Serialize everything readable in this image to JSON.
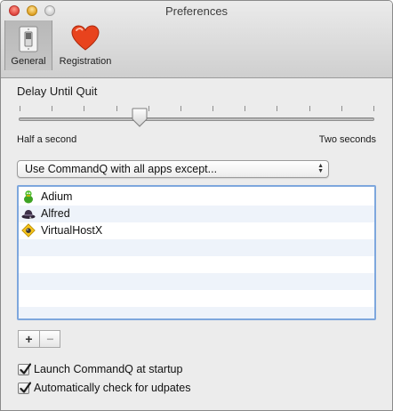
{
  "window": {
    "title": "Preferences"
  },
  "toolbar": {
    "items": [
      {
        "label": "General",
        "icon": "light-switch-icon",
        "selected": true
      },
      {
        "label": "Registration",
        "icon": "heart-icon",
        "selected": false
      }
    ]
  },
  "delay": {
    "label": "Delay Until Quit",
    "min_label": "Half a second",
    "max_label": "Two seconds",
    "tick_count": 12,
    "value_fraction": 0.34
  },
  "mode_select": {
    "value": "Use CommandQ with all apps except..."
  },
  "app_list": {
    "items": [
      {
        "name": "Adium",
        "icon": "adium-duck-icon"
      },
      {
        "name": "Alfred",
        "icon": "alfred-hat-icon"
      },
      {
        "name": "VirtualHostX",
        "icon": "virtualhostx-icon"
      }
    ],
    "empty_rows": 4,
    "focus_color": "#7ea7dd",
    "alt_row_color": "#eef3fa"
  },
  "list_buttons": {
    "add": "+",
    "remove": "−"
  },
  "options": {
    "launch_at_startup": {
      "label": "Launch CommandQ at startup",
      "checked": true
    },
    "auto_check_updates": {
      "label": "Automatically check for udpates",
      "checked": true
    }
  }
}
